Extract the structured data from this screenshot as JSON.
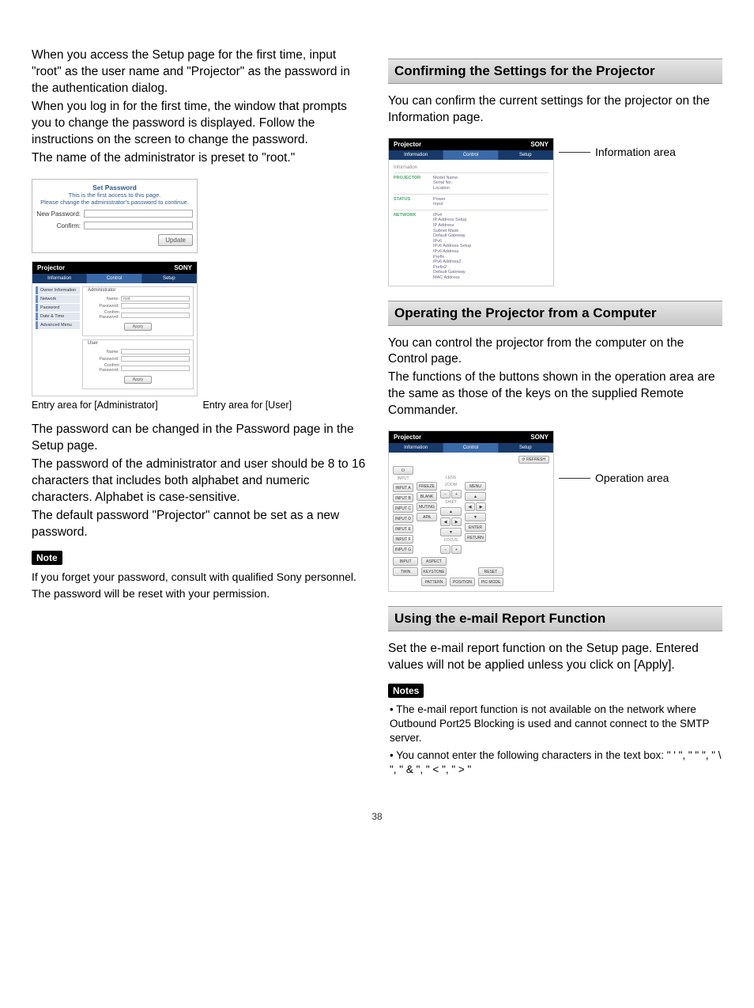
{
  "left": {
    "intro_p1": "When you access the Setup page for the first time, input \"root\" as the user name and \"Projector\" as the password in the authentication dialog.",
    "intro_p2": "When you log in for the first time, the window that prompts you to change the password is displayed. Follow the instructions on the screen to change the password.",
    "intro_p3": "The name of the administrator is preset to \"root.\"",
    "set_pw": {
      "title": "Set Password",
      "line1": "This is the first access to this page.",
      "line2": "Please change the administrator's password to continue.",
      "new_password_label": "New Password:",
      "confirm_label": "Confirm:",
      "update_btn": "Update"
    },
    "proj_window": {
      "title": "Projector",
      "brand": "SONY",
      "tabs": [
        "Information",
        "Control",
        "Setup"
      ],
      "sidebar": [
        "Owner Information",
        "Network",
        "Password",
        "Date & Time",
        "Advanced Menu"
      ],
      "admin_legend": "Administrator",
      "user_legend": "User",
      "name_label": "Name:",
      "name_value": "root",
      "password_label": "Password:",
      "confirm_label": "Confirm Password:",
      "apply_btn": "Apply"
    },
    "caption_admin": "Entry area for [Administrator]",
    "caption_user": "Entry area for [User]",
    "pw_change_p1": "The password can be changed in the Password page in the Setup page.",
    "pw_change_p2": "The password of the administrator and user should be 8 to 16 characters that includes both alphabet and numeric characters. Alphabet is case-sensitive.",
    "pw_change_p3": "The default password \"Projector\" cannot be set as a new password.",
    "note_badge": "Note",
    "note_p1": "If you forget your password, consult with qualified Sony personnel.",
    "note_p2": "The password will be reset with your permission."
  },
  "right": {
    "sec1_heading": "Confirming the Settings for the Projector",
    "sec1_p": "You can confirm the current settings for the projector on the Information page.",
    "info_callout": "Information area",
    "info_window": {
      "title": "Projector",
      "brand": "SONY",
      "tabs": [
        "Information",
        "Control",
        "Setup"
      ],
      "group_title": "Information",
      "projector_label": "PROJECTOR",
      "projector_vals": [
        "Model Name",
        "Serial No.",
        "Location"
      ],
      "status_label": "STATUS",
      "status_vals": [
        "Power",
        "Input"
      ],
      "network_label": "NETWORK",
      "network_vals": [
        "IPv4",
        "IP Address Setup",
        "IP Address",
        "Subnet Mask",
        "Default Gateway",
        "IPv6",
        "IPv6 Address Setup",
        "IPv6 Address",
        "Prefix",
        "IPv6 Address2",
        "Prefix2",
        "Default Gateway",
        "MAC Address"
      ]
    },
    "sec2_heading": "Operating the Projector from a Computer",
    "sec2_p1": "You can control the projector from the computer on the Control page.",
    "sec2_p2": "The functions of the buttons shown in the operation area are the same as those of the keys on the supplied Remote Commander.",
    "op_callout": "Operation area",
    "ctrl_window": {
      "title": "Projector",
      "brand": "SONY",
      "tabs": [
        "Information",
        "Control",
        "Setup"
      ],
      "refresh": "⟳ REFRESH",
      "power_icon": "⏻",
      "input_label": "INPUT",
      "inputs": [
        "INPUT A",
        "INPUT B",
        "INPUT C",
        "INPUT D",
        "INPUT E",
        "INPUT F",
        "INPUT G"
      ],
      "col2": [
        "FREEZE",
        "BLANK",
        "MUTING",
        "APA"
      ],
      "lens_label": "LENS",
      "lens_rows": [
        "ZOOM",
        "SHIFT",
        "FOCUS"
      ],
      "menu_btn": "MENU",
      "enter_btn": "ENTER",
      "return_btn": "RETURN",
      "bottom_left": [
        "INPUT",
        "TWIN"
      ],
      "bottom_mid": [
        "ASPECT",
        "KEYSTONE",
        "PATTERN"
      ],
      "bottom_r1": "POSITION",
      "bottom_r2a": "RESET",
      "bottom_r2b": "PIC MODE"
    },
    "sec3_heading": "Using the e-mail Report Function",
    "sec3_p": "Set the e-mail report function on the Setup page. Entered values will not be applied unless you click on [Apply].",
    "notes_badge": "Notes",
    "notes_list": [
      "The e-mail report function is not available on the network where Outbound Port25 Blocking is used and cannot connect to the SMTP server.",
      "You cannot enter the following characters in the text box: \" ' \", \" \" \", \" \\ \", \" & \", \" < \", \" > \""
    ]
  },
  "page_number": "38"
}
